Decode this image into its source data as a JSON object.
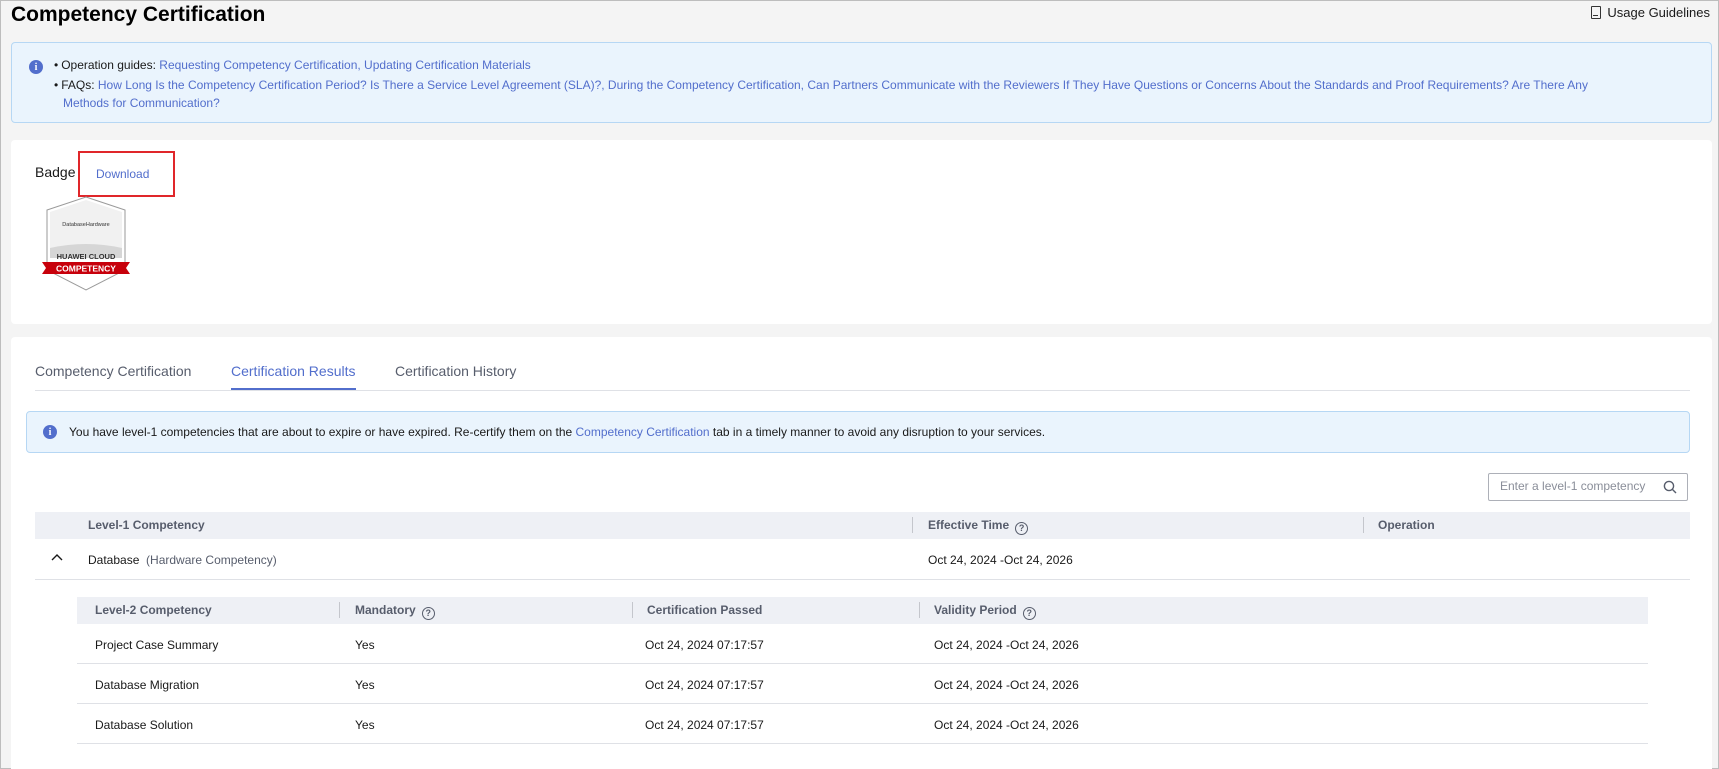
{
  "header": {
    "title": "Competency Certification",
    "usage_guidelines": "Usage Guidelines"
  },
  "guides": {
    "op_label": "Operation guides:",
    "op_links": "Requesting Competency Certification, Updating Certification Materials",
    "faq_label": "FAQs:",
    "faq_links_line1": "How Long Is the Competency Certification Period? Is There a Service Level Agreement (SLA)?, During the Competency Certification, Can Partners Communicate with the Reviewers If They Have Questions or Concerns About the Standards and Proof Requirements? Are There Any",
    "faq_links_line2": "Methods for Communication?"
  },
  "badge": {
    "label": "Badge",
    "download": "Download",
    "image_text_top": "DatabaseHardware",
    "image_text_brand": "HUAWEI CLOUD",
    "image_text_ribbon": "COMPETENCY"
  },
  "tabs": [
    {
      "label": "Competency Certification",
      "active": false
    },
    {
      "label": "Certification Results",
      "active": true
    },
    {
      "label": "Certification History",
      "active": false
    }
  ],
  "alert": {
    "before": "You have level-1 competencies that are about to expire or have expired. Re-certify them on the ",
    "link": "Competency Certification",
    "after": " tab in a timely manner to avoid any disruption to your services."
  },
  "search": {
    "placeholder": "Enter a level-1 competency"
  },
  "table": {
    "columns": [
      "Level-1 Competency",
      "Effective Time",
      "Operation"
    ],
    "rows": [
      {
        "name": "Database",
        "type": "(Hardware Competency)",
        "effective": "Oct 24, 2024 -Oct 24, 2026",
        "operation": ""
      }
    ]
  },
  "subtable": {
    "columns": [
      "Level-2 Competency",
      "Mandatory",
      "Certification Passed",
      "Validity Period"
    ],
    "rows": [
      {
        "name": "Project Case Summary",
        "mandatory": "Yes",
        "passed": "Oct 24, 2024 07:17:57",
        "validity": "Oct 24, 2024 -Oct 24, 2026"
      },
      {
        "name": "Database Migration",
        "mandatory": "Yes",
        "passed": "Oct 24, 2024 07:17:57",
        "validity": "Oct 24, 2024 -Oct 24, 2026"
      },
      {
        "name": "Database Solution",
        "mandatory": "Yes",
        "passed": "Oct 24, 2024 07:17:57",
        "validity": "Oct 24, 2024 -Oct 24, 2026"
      }
    ]
  },
  "colors": {
    "accent": "#526ecc",
    "highlight_box": "#e0262a",
    "info_bg": "#eaf4fd",
    "ribbon": "#c7000b"
  }
}
